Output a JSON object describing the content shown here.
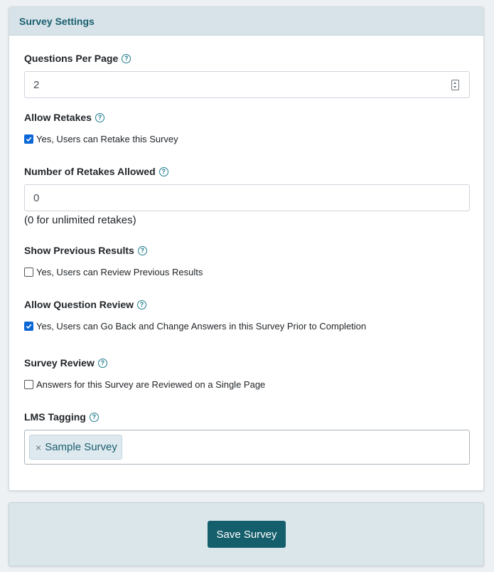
{
  "panel": {
    "title": "Survey Settings"
  },
  "fields": {
    "questions_per_page": {
      "label": "Questions Per Page",
      "value": "2"
    },
    "allow_retakes": {
      "label": "Allow Retakes",
      "checkbox_label": "Yes, Users can Retake this Survey",
      "checked": true
    },
    "number_of_retakes": {
      "label": "Number of Retakes Allowed",
      "value": "0",
      "hint": "(0 for unlimited retakes)"
    },
    "show_previous_results": {
      "label": "Show Previous Results",
      "checkbox_label": "Yes, Users can Review Previous Results",
      "checked": false
    },
    "allow_question_review": {
      "label": "Allow Question Review",
      "checkbox_label": "Yes, Users can Go Back and Change Answers in this Survey Prior to Completion",
      "checked": true
    },
    "survey_review": {
      "label": "Survey Review",
      "checkbox_label": "Answers for this Survey are Reviewed on a Single Page",
      "checked": false
    },
    "lms_tagging": {
      "label": "LMS Tagging",
      "tags": [
        "Sample Survey"
      ],
      "remove_glyph": "×"
    }
  },
  "help_glyph": "?",
  "footer": {
    "save_label": "Save Survey"
  },
  "colors": {
    "accent": "#155e6c",
    "header_bg": "#d7e3e9",
    "checkbox_checked": "#0b67d6"
  }
}
